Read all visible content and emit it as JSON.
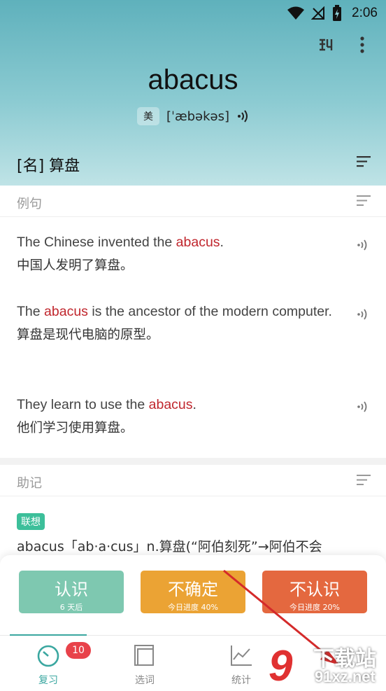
{
  "status_bar": {
    "time": "2:06"
  },
  "word": {
    "text": "abacus",
    "accent_tag": "美",
    "phonetic": "[ˈæbəkəs]"
  },
  "definition": {
    "text": "[名] 算盘"
  },
  "examples_section": {
    "title": "例句",
    "items": [
      {
        "en_before": "The Chinese invented the ",
        "en_highlight": "abacus",
        "en_after": ".",
        "cn": "中国人发明了算盘。"
      },
      {
        "en_before": "The ",
        "en_highlight": "abacus",
        "en_after": " is the ancestor of the modern computer.",
        "cn": "算盘是现代电脑的原型。"
      },
      {
        "en_before": "They learn to use the ",
        "en_highlight": "abacus",
        "en_after": ".",
        "cn": "他们学习使用算盘。"
      }
    ]
  },
  "mnemonic_section": {
    "title": "助记",
    "tag": "联想",
    "text": "abacus「ab·a·cus」n.算盘(“阿伯刻死”→阿伯不会"
  },
  "actions": {
    "know": {
      "label": "认识",
      "sub": "6 天后",
      "color": "#7ec8b0"
    },
    "unsure": {
      "label": "不确定",
      "sub": "今日进度 40%",
      "color": "#eba334"
    },
    "unknown": {
      "label": "不认识",
      "sub": "今日进度 20%",
      "color": "#e4683f"
    }
  },
  "nav": {
    "review": {
      "label": "复习",
      "badge": "10"
    },
    "select": {
      "label": "选词"
    },
    "stats": {
      "label": "统计"
    }
  },
  "watermark": {
    "logo": "9",
    "text_top": "下载站",
    "text_bottom": "91xz.net"
  },
  "colors": {
    "accent": "#3aa7a0",
    "highlight": "#c0262d",
    "badge": "#e8424a"
  }
}
